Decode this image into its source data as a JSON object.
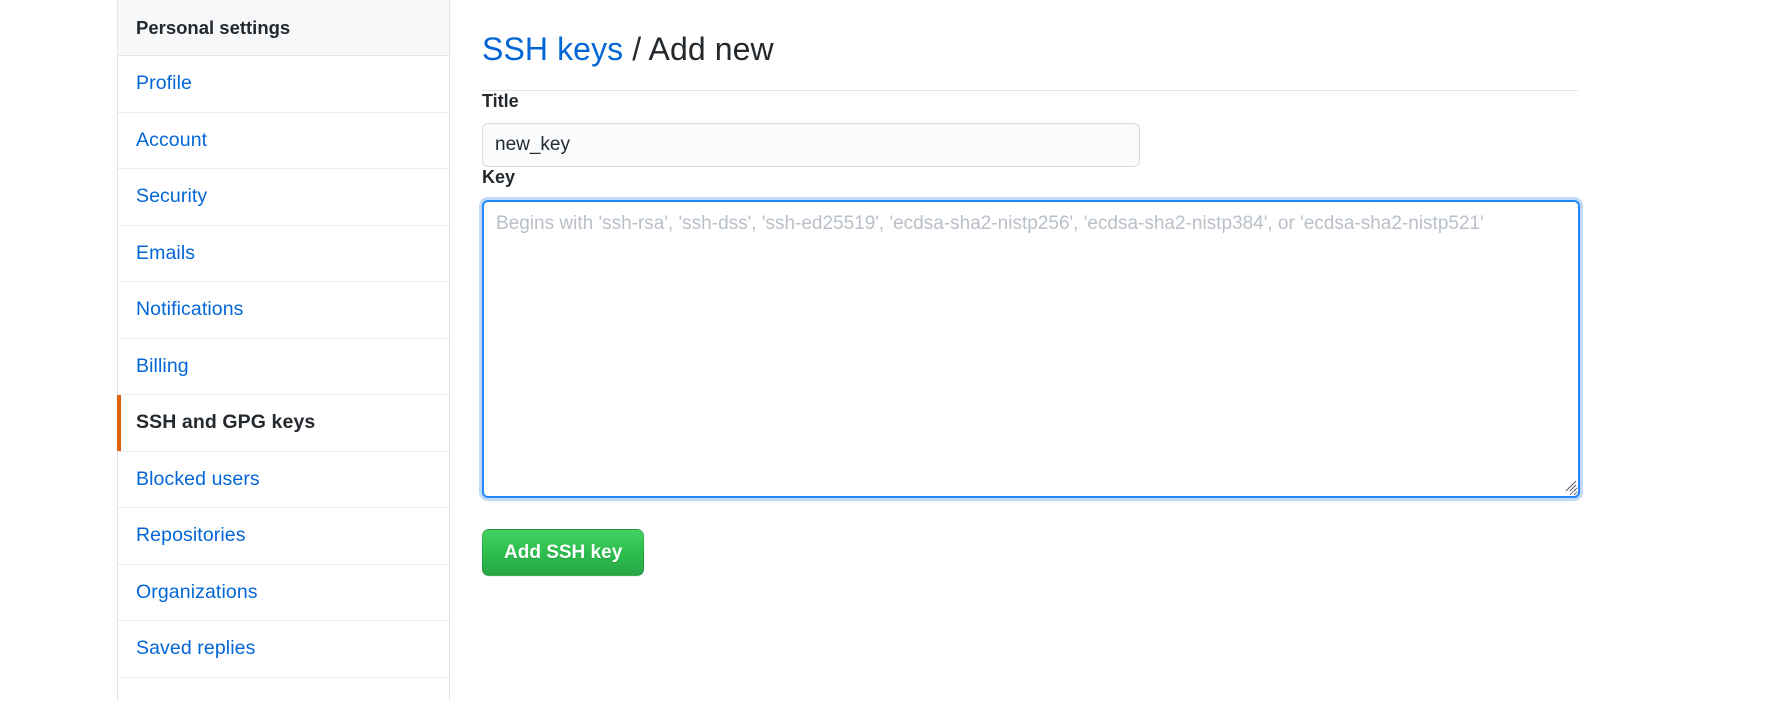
{
  "sidebar": {
    "header": "Personal settings",
    "active_item": "SSH and GPG keys",
    "items": [
      {
        "label": "Profile",
        "active": false
      },
      {
        "label": "Account",
        "active": false
      },
      {
        "label": "Security",
        "active": false
      },
      {
        "label": "Emails",
        "active": false
      },
      {
        "label": "Notifications",
        "active": false
      },
      {
        "label": "Billing",
        "active": false
      },
      {
        "label": "SSH and GPG keys",
        "active": true
      },
      {
        "label": "Blocked users",
        "active": false
      },
      {
        "label": "Repositories",
        "active": false
      },
      {
        "label": "Organizations",
        "active": false
      },
      {
        "label": "Saved replies",
        "active": false
      }
    ],
    "active_marker_color": "#e36209",
    "link_color": "#0366d6"
  },
  "main": {
    "heading": {
      "link_text": "SSH keys",
      "separator": "/",
      "current": "Add new"
    },
    "title_field": {
      "label": "Title",
      "value": "new_key",
      "placeholder": ""
    },
    "key_field": {
      "label": "Key",
      "value": "",
      "placeholder": "Begins with 'ssh-rsa', 'ssh-dss', 'ssh-ed25519', 'ecdsa-sha2-nistp256', 'ecdsa-sha2-nistp384', or 'ecdsa-sha2-nistp521'",
      "focused": true
    },
    "submit_button": {
      "label": "Add SSH key",
      "color": "#2cbe4e"
    }
  }
}
